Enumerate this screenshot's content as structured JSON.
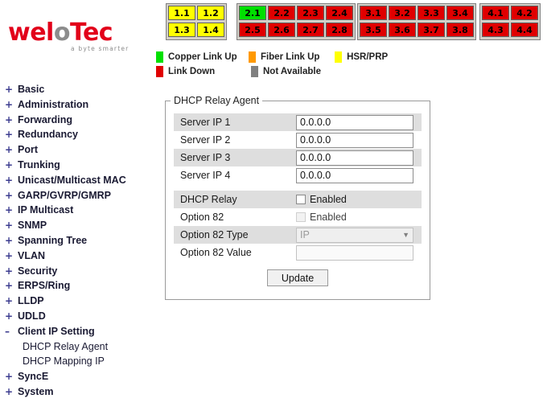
{
  "brand": {
    "wordmark_part1": "wel",
    "wordmark_part2": "o",
    "wordmark_part3": "Tec",
    "tagline": "a byte smarter"
  },
  "port_panel": {
    "groups": [
      {
        "id": "group-1",
        "ports": [
          {
            "label": "1.1",
            "color": "#ffff00",
            "status": "HSR/PRP"
          },
          {
            "label": "1.3",
            "color": "#ffff00",
            "status": "HSR/PRP"
          },
          {
            "label": "1.2",
            "color": "#ffff00",
            "status": "HSR/PRP"
          },
          {
            "label": "1.4",
            "color": "#ffff00",
            "status": "HSR/PRP"
          }
        ]
      },
      {
        "id": "group-2",
        "ports": [
          {
            "label": "2.1",
            "color": "#00e000",
            "status": "Copper Link Up"
          },
          {
            "label": "2.5",
            "color": "#e00000",
            "status": "Link Down"
          },
          {
            "label": "2.2",
            "color": "#e00000",
            "status": "Link Down"
          },
          {
            "label": "2.6",
            "color": "#e00000",
            "status": "Link Down"
          },
          {
            "label": "2.3",
            "color": "#e00000",
            "status": "Link Down"
          },
          {
            "label": "2.7",
            "color": "#e00000",
            "status": "Link Down"
          },
          {
            "label": "2.4",
            "color": "#e00000",
            "status": "Link Down"
          },
          {
            "label": "2.8",
            "color": "#e00000",
            "status": "Link Down"
          }
        ]
      },
      {
        "id": "group-3",
        "ports": [
          {
            "label": "3.1",
            "color": "#e00000",
            "status": "Link Down"
          },
          {
            "label": "3.5",
            "color": "#e00000",
            "status": "Link Down"
          },
          {
            "label": "3.2",
            "color": "#e00000",
            "status": "Link Down"
          },
          {
            "label": "3.6",
            "color": "#e00000",
            "status": "Link Down"
          },
          {
            "label": "3.3",
            "color": "#e00000",
            "status": "Link Down"
          },
          {
            "label": "3.7",
            "color": "#e00000",
            "status": "Link Down"
          },
          {
            "label": "3.4",
            "color": "#e00000",
            "status": "Link Down"
          },
          {
            "label": "3.8",
            "color": "#e00000",
            "status": "Link Down"
          }
        ]
      },
      {
        "id": "group-4",
        "ports": [
          {
            "label": "4.1",
            "color": "#e00000",
            "status": "Link Down"
          },
          {
            "label": "4.3",
            "color": "#e00000",
            "status": "Link Down"
          },
          {
            "label": "4.2",
            "color": "#e00000",
            "status": "Link Down"
          },
          {
            "label": "4.4",
            "color": "#e00000",
            "status": "Link Down"
          }
        ]
      }
    ]
  },
  "legend": {
    "rows": [
      [
        {
          "label": "Copper Link Up",
          "color": "#00e000"
        },
        {
          "label": "Fiber Link Up",
          "color": "#ff9900"
        },
        {
          "label": "HSR/PRP",
          "color": "#ffff00"
        }
      ],
      [
        {
          "label": "Link Down",
          "color": "#e00000"
        },
        {
          "label": "Not Available",
          "color": "#808080"
        }
      ]
    ]
  },
  "sidebar": {
    "items": [
      {
        "toggle": "+",
        "label": "Basic",
        "child": false
      },
      {
        "toggle": "+",
        "label": "Administration",
        "child": false
      },
      {
        "toggle": "+",
        "label": "Forwarding",
        "child": false
      },
      {
        "toggle": "+",
        "label": "Redundancy",
        "child": false
      },
      {
        "toggle": "+",
        "label": "Port",
        "child": false
      },
      {
        "toggle": "+",
        "label": "Trunking",
        "child": false
      },
      {
        "toggle": "+",
        "label": "Unicast/Multicast MAC",
        "child": false
      },
      {
        "toggle": "+",
        "label": "GARP/GVRP/GMRP",
        "child": false
      },
      {
        "toggle": "+",
        "label": "IP Multicast",
        "child": false
      },
      {
        "toggle": "+",
        "label": "SNMP",
        "child": false
      },
      {
        "toggle": "+",
        "label": "Spanning Tree",
        "child": false
      },
      {
        "toggle": "+",
        "label": "VLAN",
        "child": false
      },
      {
        "toggle": "+",
        "label": "Security",
        "child": false
      },
      {
        "toggle": "+",
        "label": "ERPS/Ring",
        "child": false
      },
      {
        "toggle": "+",
        "label": "LLDP",
        "child": false
      },
      {
        "toggle": "+",
        "label": "UDLD",
        "child": false
      },
      {
        "toggle": "–",
        "label": "Client IP Setting",
        "child": false
      },
      {
        "toggle": "",
        "label": "DHCP Relay Agent",
        "child": true
      },
      {
        "toggle": "",
        "label": "DHCP Mapping IP",
        "child": true
      },
      {
        "toggle": "+",
        "label": "SyncE",
        "child": false
      },
      {
        "toggle": "+",
        "label": "System",
        "child": false
      }
    ]
  },
  "panel": {
    "legend": "DHCP Relay Agent",
    "rows": [
      {
        "label": "Server IP 1",
        "type": "text",
        "value": "0.0.0.0",
        "striped": true,
        "disabled": false
      },
      {
        "label": "Server IP 2",
        "type": "text",
        "value": "0.0.0.0",
        "striped": false,
        "disabled": false
      },
      {
        "label": "Server IP 3",
        "type": "text",
        "value": "0.0.0.0",
        "striped": true,
        "disabled": false
      },
      {
        "label": "Server IP 4",
        "type": "text",
        "value": "0.0.0.0",
        "striped": false,
        "disabled": false
      },
      {
        "label": "DHCP Relay",
        "type": "checkbox",
        "value": "Enabled",
        "checked": false,
        "striped": true,
        "disabled": false
      },
      {
        "label": "Option 82",
        "type": "checkbox",
        "value": "Enabled",
        "checked": false,
        "striped": false,
        "disabled": true
      },
      {
        "label": "Option 82 Type",
        "type": "select",
        "value": "IP",
        "striped": true,
        "disabled": true
      },
      {
        "label": "Option 82 Value",
        "type": "text",
        "value": "",
        "striped": false,
        "disabled": true
      }
    ],
    "update_label": "Update"
  }
}
